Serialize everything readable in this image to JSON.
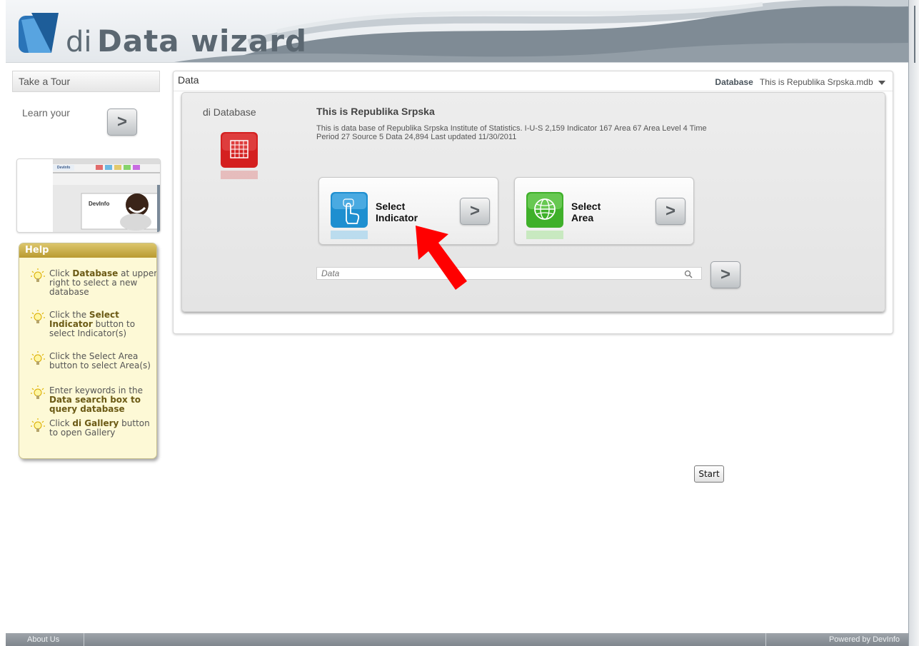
{
  "header": {
    "logo_prefix": "di",
    "logo_title": "Data wizard"
  },
  "sidebar": {
    "tour_title": "Take a Tour",
    "learn_text": "Learn your",
    "learn_button_icon": "chevron-right-icon",
    "thumb_brand_top": "DevInfo",
    "thumb_brand": "DevInfo"
  },
  "help": {
    "title": "Help",
    "items": [
      {
        "pre": "Click ",
        "bold": "Database",
        "post": " at upper right to select a new database"
      },
      {
        "pre": "Click the ",
        "bold": "Select Indicator",
        "post": " button to select Indicator(s)"
      },
      {
        "pre": "Click the Select Area button to select Area(s)",
        "bold": "",
        "post": ""
      },
      {
        "pre": "Enter keywords in the ",
        "bold": "Data search box to query database",
        "post": ""
      },
      {
        "pre": "Click ",
        "bold": "di Gallery",
        "post": " button to open Gallery"
      }
    ]
  },
  "data_panel": {
    "title": "Data",
    "db_label": "Database",
    "db_value": "This is Republika Srpska.mdb",
    "section_label": "di Database",
    "db_title": "This is Republika Srpska",
    "db_description": "This is data base of Republika Srpska Institute of Statistics. I-U-S 2,159 Indicator 167 Area 67 Area Level 4 Time Period 27 Source 5 Data 24,894 Last updated 11/30/2011",
    "select_indicator_line1": "Select",
    "select_indicator_line2": "Indicator",
    "select_area_line1": "Select",
    "select_area_line2": "Area",
    "search_placeholder": "Data",
    "arrow_glyph": ">"
  },
  "start_label": "Start",
  "footer": {
    "about": "About Us",
    "powered": "Powered by DevInfo"
  },
  "colors": {
    "help_bg": "#fdf9d6",
    "help_title": "#c9ad45",
    "indicator_icon": "#1e8fd0",
    "area_icon": "#3fb02a",
    "database_icon": "#d42020",
    "annotation_arrow": "#ff0000"
  }
}
